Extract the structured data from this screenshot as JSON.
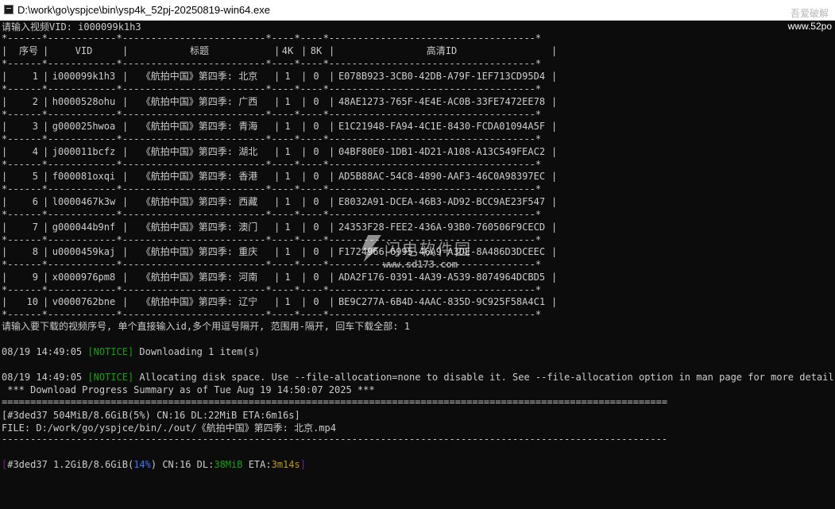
{
  "window": {
    "title": "D:\\work\\go\\yspjce\\bin\\ysp4k_52pj-20250819-win64.exe",
    "watermark_top_right": "吾爱破解",
    "watermark_url": "www.52po",
    "watermark_center_name": "闪电软件园",
    "watermark_center_url": "www.sd173.com"
  },
  "prompt_vid": "请输入视频VID: i000099k1h3",
  "table": {
    "border_line": "*------*------------*-------------------------*----*----*------------------------------------*",
    "headers": [
      "序号",
      "VID",
      "标题",
      "4K",
      "8K",
      "高清ID"
    ],
    "rows": [
      {
        "no": "1",
        "vid": "i000099k1h3",
        "title": "《航拍中国》第四季: 北京",
        "k4": "1",
        "k8": "0",
        "hdid": "E078B923-3CB0-42DB-A79F-1EF713CD95D4"
      },
      {
        "no": "2",
        "vid": "h0000528ohu",
        "title": "《航拍中国》第四季: 广西",
        "k4": "1",
        "k8": "0",
        "hdid": "48AE1273-765F-4E4E-AC0B-33FE7472EE78"
      },
      {
        "no": "3",
        "vid": "g000025hwoa",
        "title": "《航拍中国》第四季: 青海",
        "k4": "1",
        "k8": "0",
        "hdid": "E1C21948-FA94-4C1E-8430-FCDA01094A5F"
      },
      {
        "no": "4",
        "vid": "j000011bcfz",
        "title": "《航拍中国》第四季: 湖北",
        "k4": "1",
        "k8": "0",
        "hdid": "04BF80E0-1DB1-4D21-A108-A13C549FEAC2"
      },
      {
        "no": "5",
        "vid": "f000081oxqi",
        "title": "《航拍中国》第四季: 香港",
        "k4": "1",
        "k8": "0",
        "hdid": "AD5B88AC-54C8-4890-AAF3-46C0A98397EC"
      },
      {
        "no": "6",
        "vid": "l0000467k3w",
        "title": "《航拍中国》第四季: 西藏",
        "k4": "1",
        "k8": "0",
        "hdid": "E8032A91-DCEA-46B3-AD92-BCC9AE23F547"
      },
      {
        "no": "7",
        "vid": "g000044b9nf",
        "title": "《航拍中国》第四季: 澳门",
        "k4": "1",
        "k8": "0",
        "hdid": "24353F28-FEE2-436A-93B0-760506F9CECD"
      },
      {
        "no": "8",
        "vid": "u0000459kaj",
        "title": "《航拍中国》第四季: 重庆",
        "k4": "1",
        "k8": "0",
        "hdid": "F1724966-6995-46A9-A3DE-8A486D3DCEEC"
      },
      {
        "no": "9",
        "vid": "x0000976pm8",
        "title": "《航拍中国》第四季: 河南",
        "k4": "1",
        "k8": "0",
        "hdid": "ADA2F176-0391-4A39-A539-8074964DCBD5"
      },
      {
        "no": "10",
        "vid": "v0000762bne",
        "title": "《航拍中国》第四季: 辽宁",
        "k4": "1",
        "k8": "0",
        "hdid": "BE9C277A-6B4D-4AAC-835D-9C925F58A4C1"
      }
    ]
  },
  "prompt_select": "请输入要下载的视频序号, 单个直接输入id,多个用逗号隔开, 范围用-隔开, 回车下载全部: 1",
  "log": {
    "l1_time": "08/19 14:49:05 ",
    "l1_open": "[",
    "l1_tag": "NOTICE",
    "l1_close": "]",
    "l1_msg": " Downloading 1 item(s)",
    "l2_time": "08/19 14:49:05 ",
    "l2_open": "[",
    "l2_tag": "NOTICE",
    "l2_close": "]",
    "l2_msg": " Allocating disk space. Use --file-allocation=none to disable it. See --file-allocation option in man page for more details.",
    "summary": " *** Download Progress Summary as of Tue Aug 19 14:50:07 2025 ***",
    "double_rule": "=================================================================================================================================",
    "progress1": "[#3ded37 504MiB/8.6GiB(5%) CN:16 DL:22MiB ETA:6m16s]",
    "file": "FILE: D:/work/go/yspjce/bin/./out/《航拍中国》第四季: 北京.mp4",
    "single_rule": "---------------------------------------------------------------------------------------------------------------------------------",
    "p2_open": "[",
    "p2_id": "#3ded37 1.2GiB/8.6GiB(",
    "p2_pct": "14%",
    "p2_mid": ") CN:16 DL:",
    "p2_dl": "38MiB",
    "p2_eta_label": " ETA:",
    "p2_eta": "3m14s",
    "p2_close": "]"
  }
}
